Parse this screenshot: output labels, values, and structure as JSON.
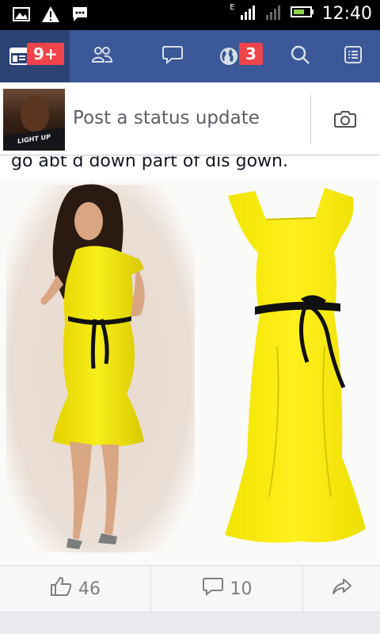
{
  "status_bar": {
    "time": "12:40",
    "network_type": "E",
    "icons": [
      "gallery-icon",
      "warning-icon",
      "message-icon",
      "signal-icon",
      "battery-icon"
    ]
  },
  "nav": {
    "items": [
      {
        "name": "news-feed",
        "icon": "news-feed-icon",
        "badge": "9+"
      },
      {
        "name": "friend-requests",
        "icon": "friends-icon",
        "badge": ""
      },
      {
        "name": "messages",
        "icon": "chat-icon",
        "badge": ""
      },
      {
        "name": "notifications",
        "icon": "globe-icon",
        "badge": "3"
      },
      {
        "name": "search",
        "icon": "search-icon",
        "badge": ""
      },
      {
        "name": "more",
        "icon": "menu-icon",
        "badge": ""
      }
    ],
    "colors": {
      "bar": "#3b5998",
      "active": "#2d4373",
      "badge": "#f0434a"
    }
  },
  "composer": {
    "placeholder": "Post a status update",
    "avatar_shirt_text": "LIGHT UP"
  },
  "post": {
    "text": "go abt d down part of dis gown.",
    "likes": "46",
    "comments": "10"
  }
}
